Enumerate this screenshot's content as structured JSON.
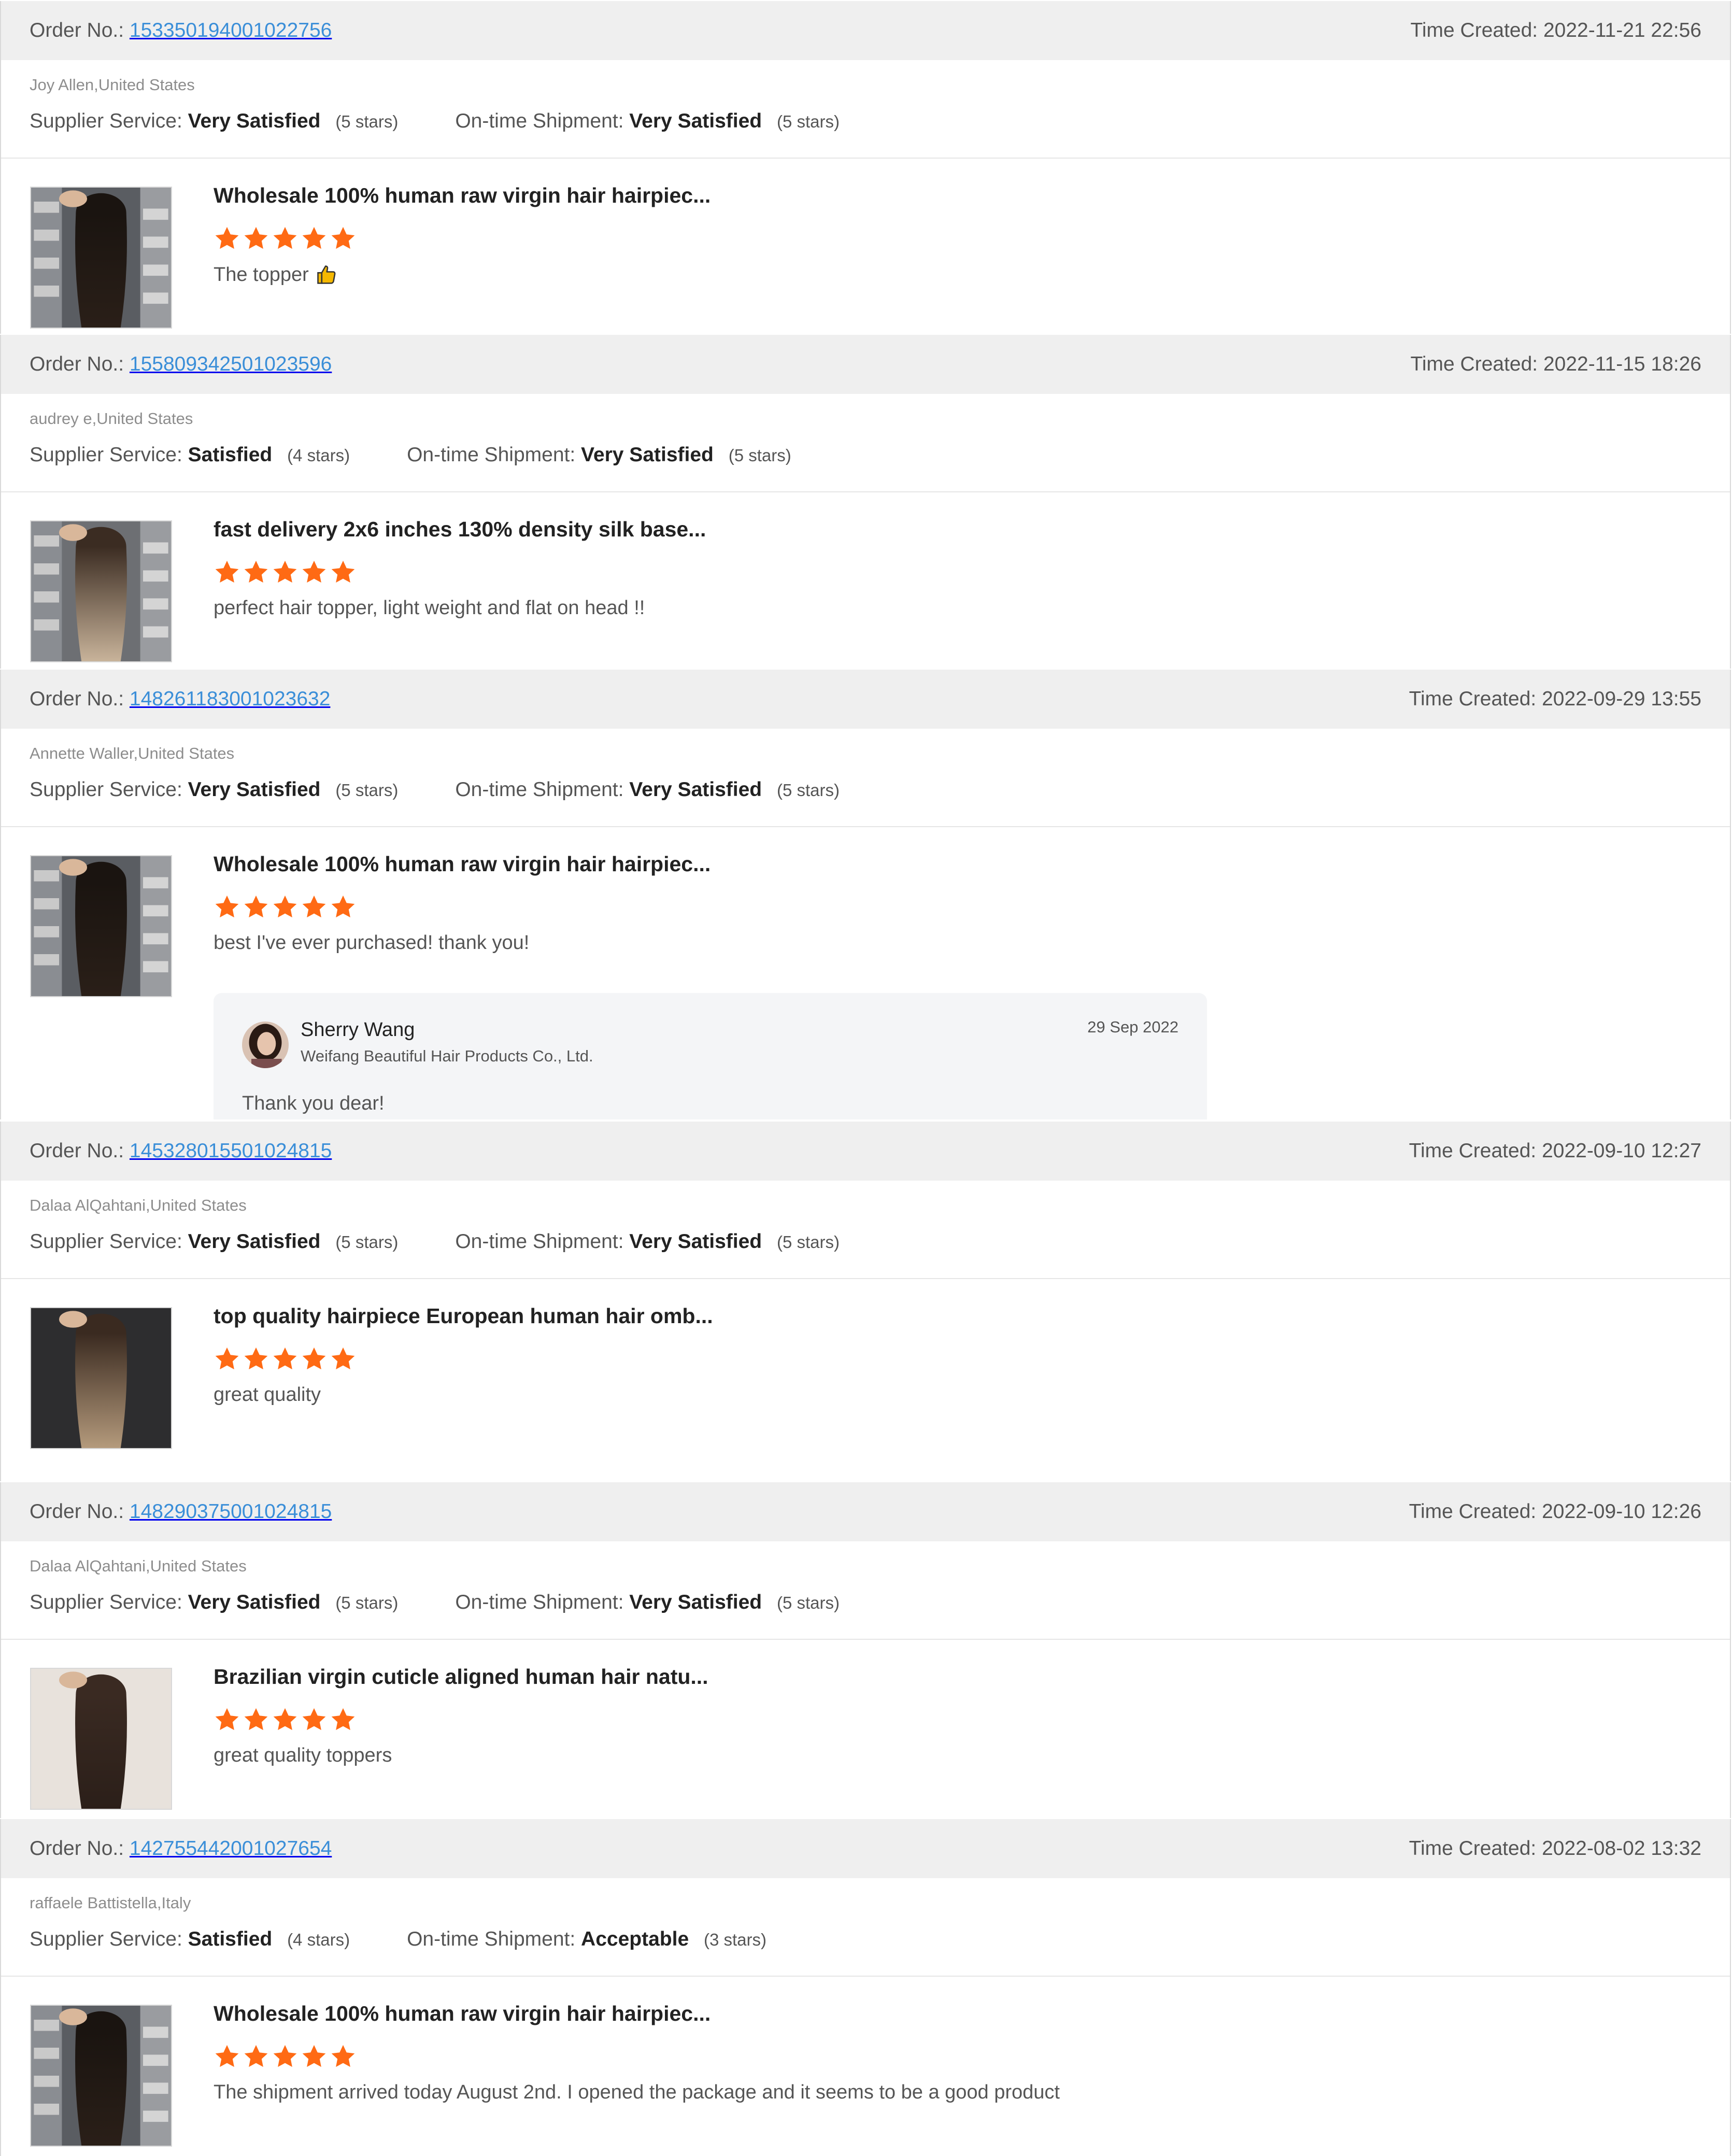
{
  "labels": {
    "order_no": "Order No.:",
    "time_created": "Time Created:",
    "supplier_service": "Supplier Service:",
    "ontime_shipment": "On-time Shipment:"
  },
  "reviews": [
    {
      "order_no": "153350194001022756",
      "time_created": "2022-11-21 22:56",
      "buyer": "Joy Allen,United States",
      "supplier_rating": "Very Satisfied",
      "supplier_stars": "(5 stars)",
      "shipment_rating": "Very Satisfied",
      "shipment_stars": "(5 stars)",
      "product_title": "Wholesale 100% human raw virgin hair hairpiec...",
      "stars": 5,
      "comment": "The topper",
      "comment_icon": "thumbs-up-icon"
    },
    {
      "order_no": "155809342501023596",
      "time_created": "2022-11-15 18:26",
      "buyer": "audrey e,United States",
      "supplier_rating": "Satisfied",
      "supplier_stars": "(4 stars)",
      "shipment_rating": "Very Satisfied",
      "shipment_stars": "(5 stars)",
      "product_title": "fast delivery 2x6 inches 130% density silk base...",
      "stars": 5,
      "comment": "perfect hair topper, light weight and flat on head !!"
    },
    {
      "order_no": "148261183001023632",
      "time_created": "2022-09-29 13:55",
      "buyer": "Annette Waller,United States",
      "supplier_rating": "Very Satisfied",
      "supplier_stars": "(5 stars)",
      "shipment_rating": "Very Satisfied",
      "shipment_stars": "(5 stars)",
      "product_title": "Wholesale 100% human raw virgin hair hairpiec...",
      "stars": 5,
      "comment": "best I've ever purchased! thank you!",
      "reply": {
        "name": "Sherry Wang",
        "company": "Weifang Beautiful Hair Products Co., Ltd.",
        "date": "29 Sep 2022",
        "text": "Thank you dear!"
      }
    },
    {
      "order_no": "145328015501024815",
      "time_created": "2022-09-10 12:27",
      "buyer": "Dalaa AlQahtani,United States",
      "supplier_rating": "Very Satisfied",
      "supplier_stars": "(5 stars)",
      "shipment_rating": "Very Satisfied",
      "shipment_stars": "(5 stars)",
      "product_title": "top quality hairpiece European human hair omb...",
      "stars": 5,
      "comment": "great quality"
    },
    {
      "order_no": "148290375001024815",
      "time_created": "2022-09-10 12:26",
      "buyer": "Dalaa AlQahtani,United States",
      "supplier_rating": "Very Satisfied",
      "supplier_stars": "(5 stars)",
      "shipment_rating": "Very Satisfied",
      "shipment_stars": "(5 stars)",
      "product_title": "Brazilian virgin cuticle aligned human hair natu...",
      "stars": 5,
      "comment": "great quality toppers"
    },
    {
      "order_no": "142755442001027654",
      "time_created": "2022-08-02 13:32",
      "buyer": "raffaele Battistella,Italy",
      "supplier_rating": "Satisfied",
      "supplier_stars": "(4 stars)",
      "shipment_rating": "Acceptable",
      "shipment_stars": "(3 stars)",
      "product_title": "Wholesale 100% human raw virgin hair hairpiec...",
      "stars": 5,
      "comment": "The shipment arrived today August 2nd. I opened the package and it seems to be a good product"
    }
  ],
  "colors": {
    "star": "#ff6a14",
    "link": "#3a8ed8",
    "header_bg": "#efefef"
  }
}
